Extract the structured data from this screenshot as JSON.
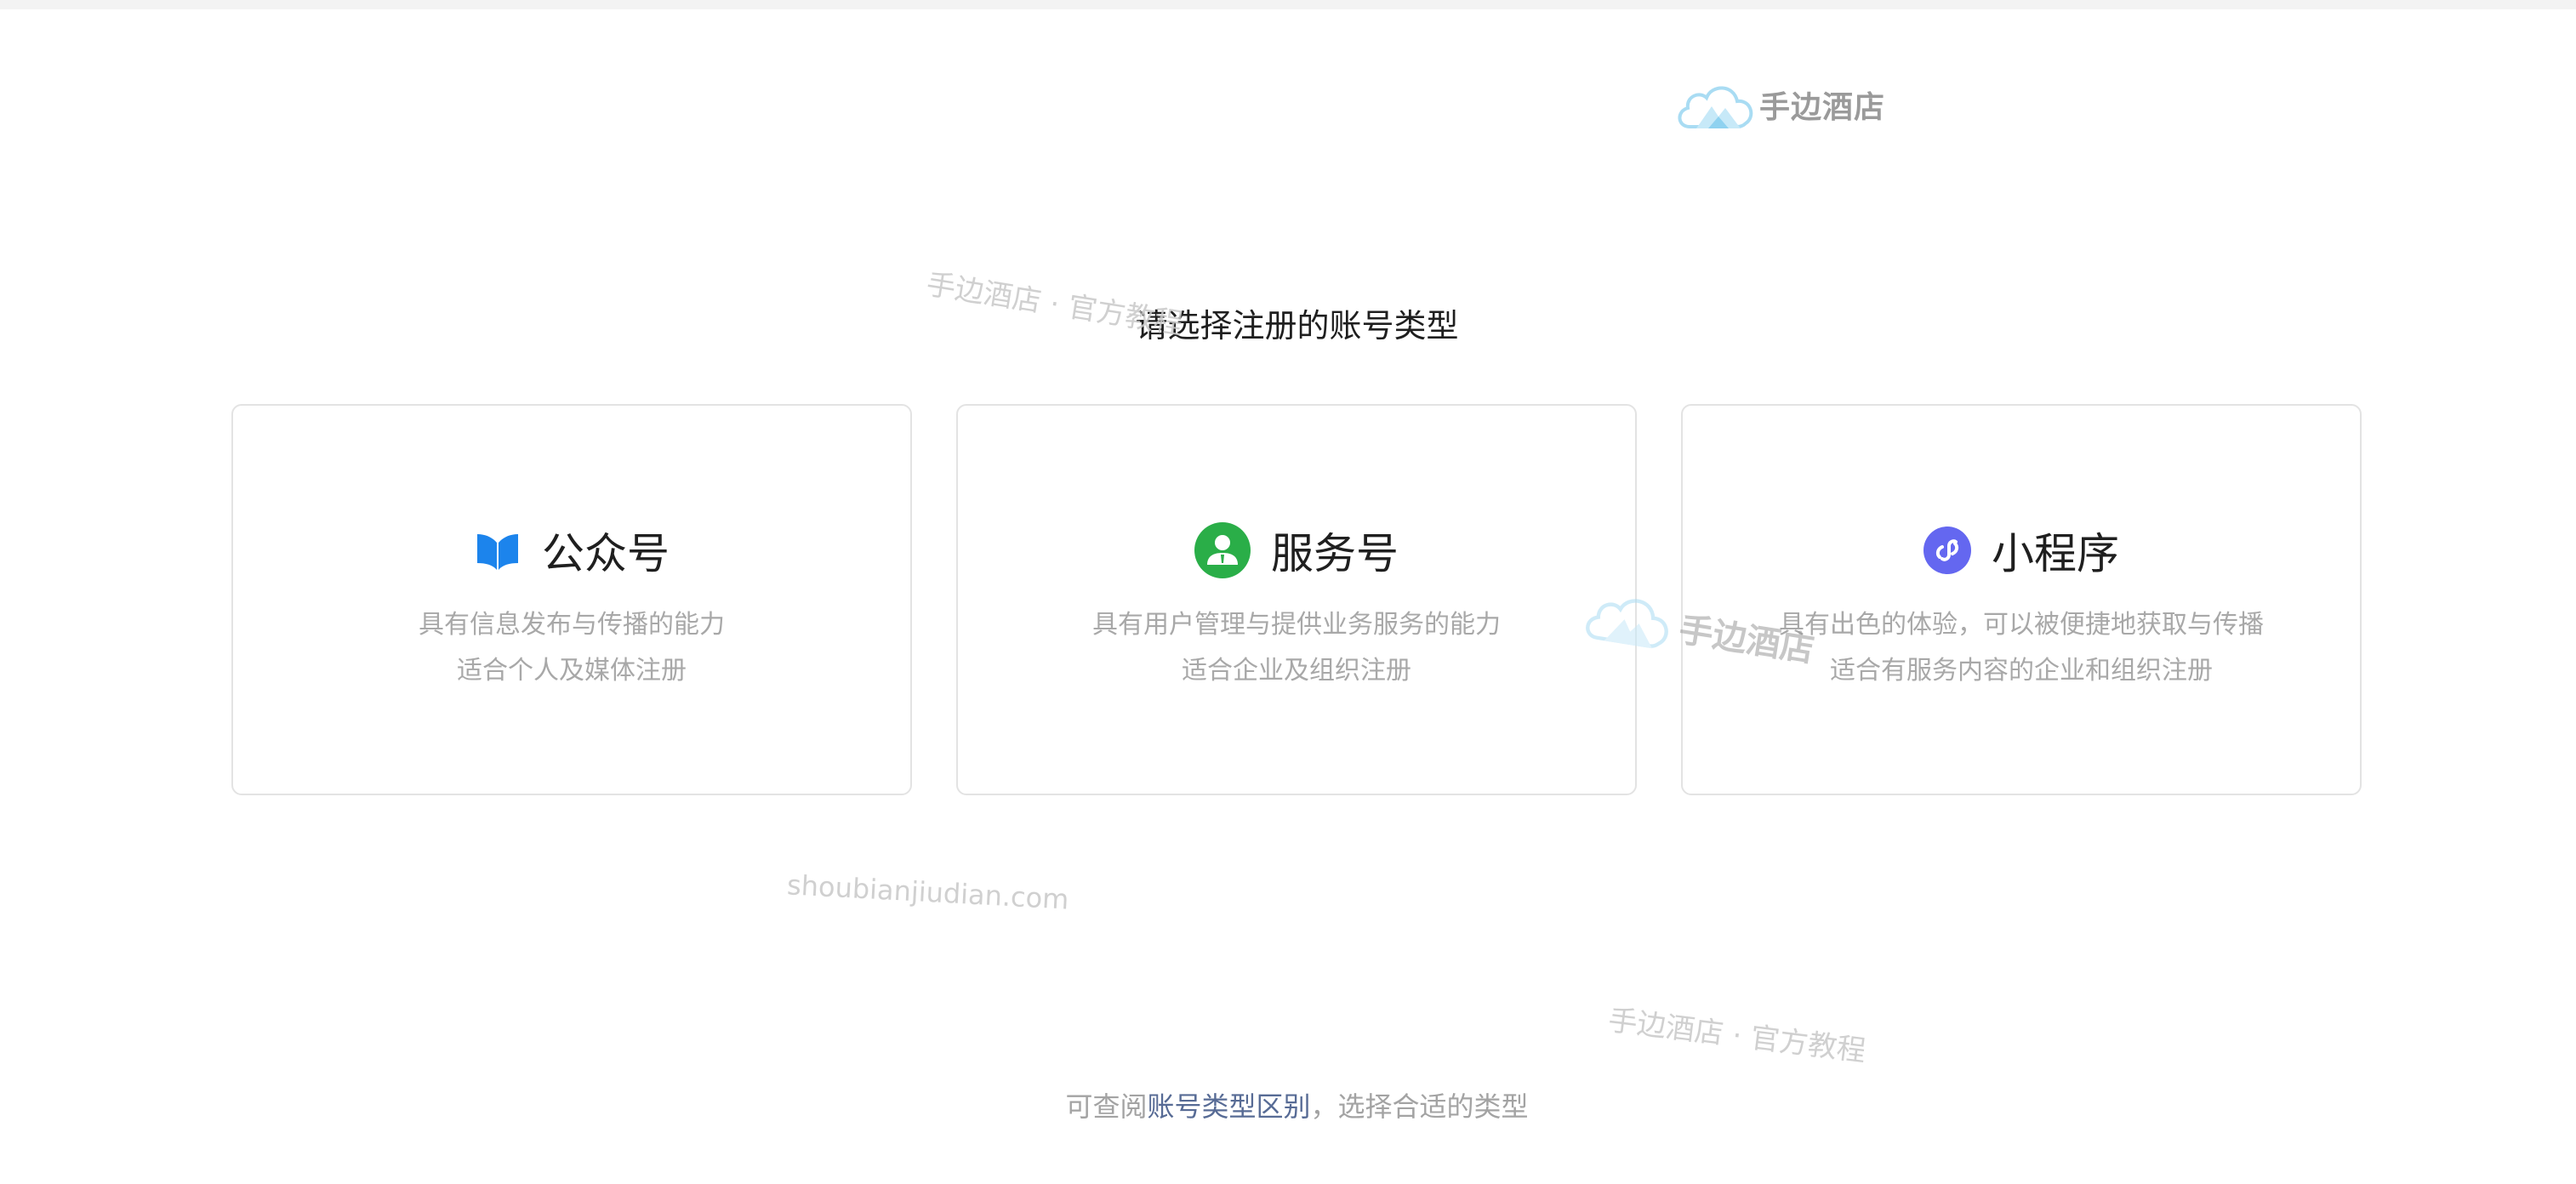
{
  "logo": {
    "text": "手边酒店"
  },
  "title": "请选择注册的账号类型",
  "cards": [
    {
      "name": "公众号",
      "icon": "book-icon",
      "color": "#1c84ec",
      "desc": [
        "具有信息发布与传播的能力",
        "适合个人及媒体注册"
      ]
    },
    {
      "name": "服务号",
      "icon": "user-icon",
      "color": "#2aae48",
      "desc": [
        "具有用户管理与提供业务服务的能力",
        "适合企业及组织注册"
      ]
    },
    {
      "name": "小程序",
      "icon": "link-icon",
      "color": "#6467f0",
      "desc": [
        "具有出色的体验，可以被便捷地获取与传播",
        "适合有服务内容的企业和组织注册"
      ]
    }
  ],
  "footer": {
    "prefix": "可查阅",
    "link": "账号类型区别",
    "suffix": "，选择合适的类型"
  },
  "watermarks": {
    "top": "手边酒店 · 官方教程",
    "url": "shoubianjiudian.com",
    "bottom": "手边酒店 · 官方教程",
    "mid": "手边酒店"
  }
}
